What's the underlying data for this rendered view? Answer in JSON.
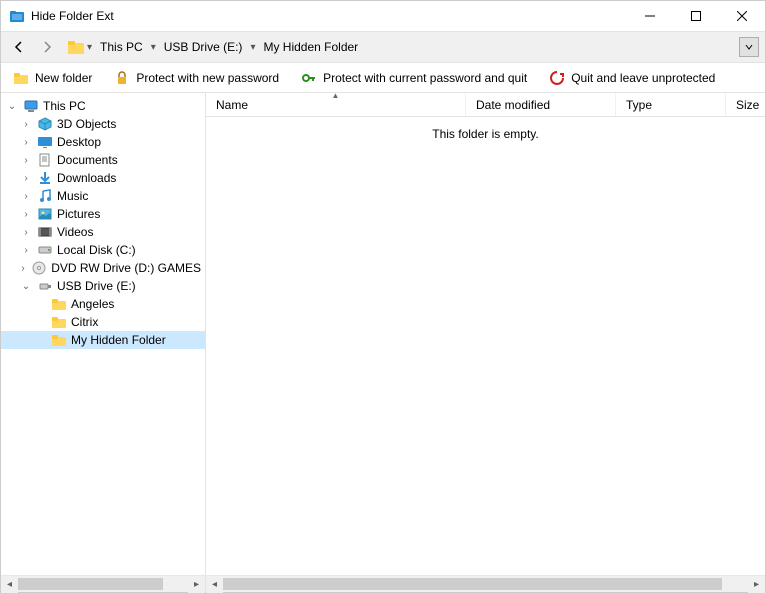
{
  "window": {
    "title": "Hide Folder Ext"
  },
  "breadcrumb": {
    "items": [
      {
        "label": "This PC"
      },
      {
        "label": "USB Drive (E:)"
      },
      {
        "label": "My Hidden Folder"
      }
    ]
  },
  "toolbar": {
    "new_folder": "New folder",
    "protect_new": "Protect with new password",
    "protect_current": "Protect with current password and quit",
    "quit_unprotected": "Quit and leave unprotected"
  },
  "tree": {
    "root": {
      "label": "This PC",
      "expanded": true
    },
    "items": [
      {
        "label": "3D Objects",
        "icon": "3d"
      },
      {
        "label": "Desktop",
        "icon": "desktop"
      },
      {
        "label": "Documents",
        "icon": "documents"
      },
      {
        "label": "Downloads",
        "icon": "downloads"
      },
      {
        "label": "Music",
        "icon": "music"
      },
      {
        "label": "Pictures",
        "icon": "pictures"
      },
      {
        "label": "Videos",
        "icon": "videos"
      },
      {
        "label": "Local Disk (C:)",
        "icon": "disk"
      },
      {
        "label": "DVD RW Drive (D:) GAMES",
        "icon": "dvd"
      }
    ],
    "usb": {
      "label": "USB Drive (E:)",
      "expanded": true
    },
    "usb_children": [
      {
        "label": "Angeles"
      },
      {
        "label": "Citrix"
      },
      {
        "label": "My Hidden Folder",
        "selected": true
      }
    ]
  },
  "columns": {
    "name": "Name",
    "date": "Date modified",
    "type": "Type",
    "size": "Size"
  },
  "empty_message": "This folder is empty."
}
